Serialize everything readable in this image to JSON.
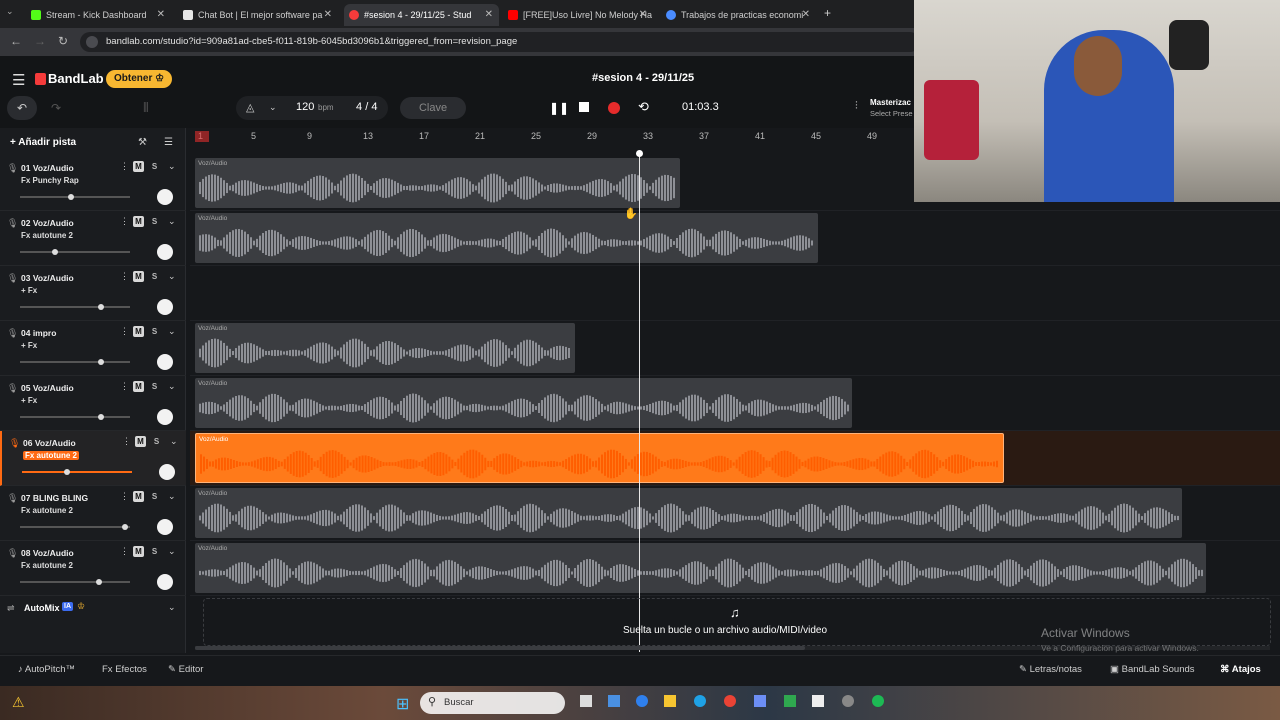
{
  "browser": {
    "tabs": [
      {
        "label": "Stream - Kick Dashboard",
        "color": "#53fc18"
      },
      {
        "label": "Chat Bot | El mejor software pa",
        "color": "#e6e6e6"
      },
      {
        "label": "#sesion 4 - 29/11/25 - Stud",
        "color": "#f53b3b"
      },
      {
        "label": "[FREE]Uso Livre] No Melody Ha",
        "color": "#ff0000"
      },
      {
        "label": "Trabajos de practicas economi",
        "color": "#4a8cff"
      }
    ],
    "url": "bandlab.com/studio?id=909a81ad-cbe5-f011-819b-6045bd3096b1&triggered_from=revision_page"
  },
  "app": {
    "brand": "BandLab",
    "obtener": "Obtener",
    "project_title": "#sesion 4 - 29/11/25",
    "bpm": "120",
    "bpm_unit": "bpm",
    "time_sig_num": "4",
    "time_sig_sep": "/",
    "time_sig_den": "4",
    "key": "Clave",
    "time": "01:03.3",
    "master_label": "Masterizac",
    "master_sub": "Select Prese",
    "add_track": "Añadir pista"
  },
  "ruler": [
    "1",
    "5",
    "9",
    "13",
    "17",
    "21",
    "25",
    "29",
    "33",
    "37",
    "41",
    "45",
    "49"
  ],
  "tracks": [
    {
      "name": "01  Voz/Audio",
      "fx": "Fx Punchy Rap",
      "vol": 0.47,
      "sel": false
    },
    {
      "name": "02  Voz/Audio",
      "fx": "Fx autotune 2",
      "vol": 0.32,
      "sel": false
    },
    {
      "name": "03  Voz/Audio",
      "fx": "+ Fx",
      "vol": 0.75,
      "sel": false
    },
    {
      "name": "04  impro",
      "fx": "+ Fx",
      "vol": 0.75,
      "sel": false
    },
    {
      "name": "05  Voz/Audio",
      "fx": "+ Fx",
      "vol": 0.75,
      "sel": false
    },
    {
      "name": "06  Voz/Audio",
      "fx": "Fx autotune 2",
      "vol": 0.42,
      "sel": true
    },
    {
      "name": "07  BLING BLING",
      "fx": "Fx autotune 2",
      "vol": 0.97,
      "sel": false
    },
    {
      "name": "08  Voz/Audio",
      "fx": "Fx autotune 2",
      "vol": 0.73,
      "sel": false
    }
  ],
  "clip_label": "Voz/Audio",
  "automix": {
    "label": "AutoMix",
    "badge": "IA"
  },
  "drop_text": "Suelta un bucle o un archivo audio/MIDI/video",
  "bottom": {
    "autopitch": "AutoPitch™",
    "efectos": "Efectos",
    "editor": "Editor",
    "letras": "Letras/notas",
    "sounds": "BandLab Sounds",
    "atajos": "Atajos"
  },
  "windows": {
    "activar": "Activar Windows",
    "activar_sub": "Ve a Configuración para activar Windows.",
    "search": "Buscar"
  },
  "colors": {
    "accent": "#ff6a13",
    "obtener": "#f7b731",
    "record": "#e52b2b"
  }
}
